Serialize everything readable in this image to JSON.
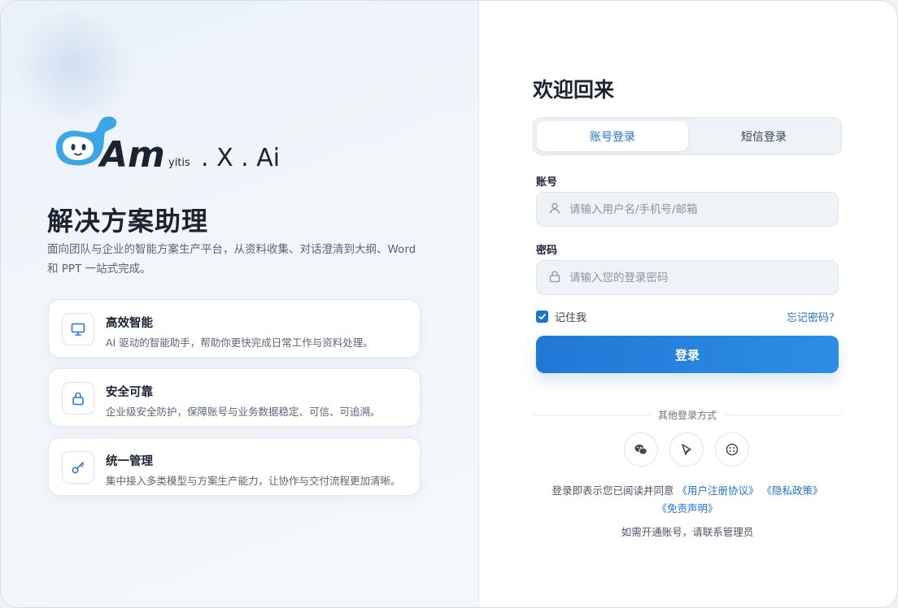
{
  "brand": {
    "logo_text": "Am",
    "logo_small": "yitis",
    "logo_suffix": ". X . Ai",
    "title": "解决方案助理",
    "description": "面向团队与企业的智能方案生产平台，从资料收集、对话澄清到大纲、Word 和 PPT 一站式完成。"
  },
  "features": [
    {
      "icon": "monitor-icon",
      "title": "高效智能",
      "desc": "AI 驱动的智能助手，帮助你更快完成日常工作与资料处理。"
    },
    {
      "icon": "lock-icon",
      "title": "安全可靠",
      "desc": "企业级安全防护，保障账号与业务数据稳定、可信、可追溯。"
    },
    {
      "icon": "key-icon",
      "title": "统一管理",
      "desc": "集中接入多类模型与方案生产能力，让协作与交付流程更加清晰。"
    }
  ],
  "login": {
    "welcome": "欢迎回来",
    "tabs": [
      "账号登录",
      "短信登录"
    ],
    "active_tab": 0,
    "account_label": "账号",
    "account_placeholder": "请输入用户名/手机号/邮箱",
    "account_value": "",
    "password_label": "密码",
    "password_placeholder": "请输入您的登录密码",
    "password_value": "",
    "remember_label": "记住我",
    "remember_checked": true,
    "forgot_label": "忘记密码?",
    "submit_label": "登录",
    "other_methods": "其他登录方式",
    "social": [
      "wechat-icon",
      "feishu-icon",
      "dingtalk-icon"
    ],
    "agreement_prefix": "登录即表示您已阅读并同意",
    "agreement_user": "《用户注册协议》",
    "agreement_privacy": "《隐私政策》",
    "agreement_disclaimer": "《免责声明》",
    "contact": "如需开通账号，请联系管理员"
  },
  "colors": {
    "accent": "#1f73d8",
    "logo_blue": "#3aa6e8"
  }
}
